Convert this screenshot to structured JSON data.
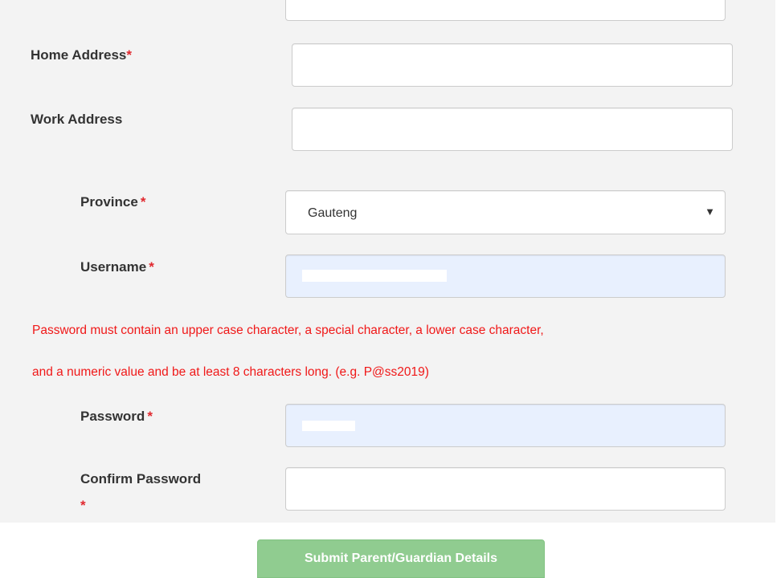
{
  "form": {
    "home_address": {
      "label": "Home Address",
      "required_mark": "*",
      "value": ""
    },
    "work_address": {
      "label": "Work Address",
      "value": ""
    },
    "province": {
      "label": "Province",
      "required_mark": "*",
      "value": "Gauteng",
      "arrow": "▼"
    },
    "username": {
      "label": "Username",
      "required_mark": "*"
    },
    "password_notice": {
      "line1": "Password must contain an upper case character, a special character, a lower case character,",
      "line2": "and a numeric value and be at least 8 characters long. (e.g. P@ss2019)"
    },
    "password": {
      "label": "Password",
      "required_mark": "*"
    },
    "confirm_password": {
      "label": "Confirm Password",
      "required_mark": "*",
      "value": ""
    }
  },
  "submit": {
    "label": "Submit Parent/Guardian Details"
  },
  "colors": {
    "panel_bg": "#f3f3f3",
    "required": "#e0282e",
    "notice": "#f01818",
    "autofill_bg": "#e8f0fe",
    "submit_bg": "#90cc90"
  },
  "icons": {
    "select_arrow": "chevron-down-icon"
  }
}
